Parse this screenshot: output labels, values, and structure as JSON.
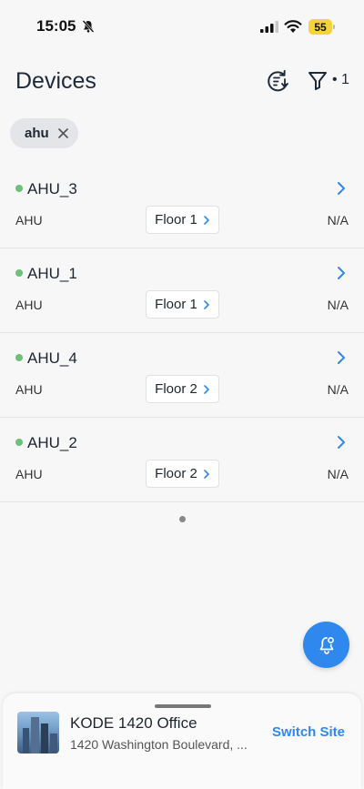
{
  "status_bar": {
    "time": "15:05",
    "battery": "55",
    "battery_color": "#f5d33b"
  },
  "header": {
    "title": "Devices",
    "filter_count": "• 1"
  },
  "filter_chip": {
    "label": "ahu"
  },
  "devices": [
    {
      "name": "AHU_3",
      "type": "AHU",
      "floor": "Floor 1",
      "value": "N/A",
      "status_color": "#6cc07a"
    },
    {
      "name": "AHU_1",
      "type": "AHU",
      "floor": "Floor 1",
      "value": "N/A",
      "status_color": "#6cc07a"
    },
    {
      "name": "AHU_4",
      "type": "AHU",
      "floor": "Floor 2",
      "value": "N/A",
      "status_color": "#6cc07a"
    },
    {
      "name": "AHU_2",
      "type": "AHU",
      "floor": "Floor 2",
      "value": "N/A",
      "status_color": "#6cc07a"
    }
  ],
  "site": {
    "name": "KODE 1420 Office",
    "address": "1420 Washington Boulevard, ...",
    "switch_label": "Switch Site"
  },
  "colors": {
    "accent": "#2f88ed",
    "online": "#6cc07a"
  },
  "icons": {
    "status_bar": [
      "bell-off-icon",
      "signal-icon",
      "wifi-icon",
      "battery-icon"
    ],
    "header": [
      "sort-refresh-icon",
      "filter-icon"
    ],
    "fab": "notification-bell-icon"
  }
}
